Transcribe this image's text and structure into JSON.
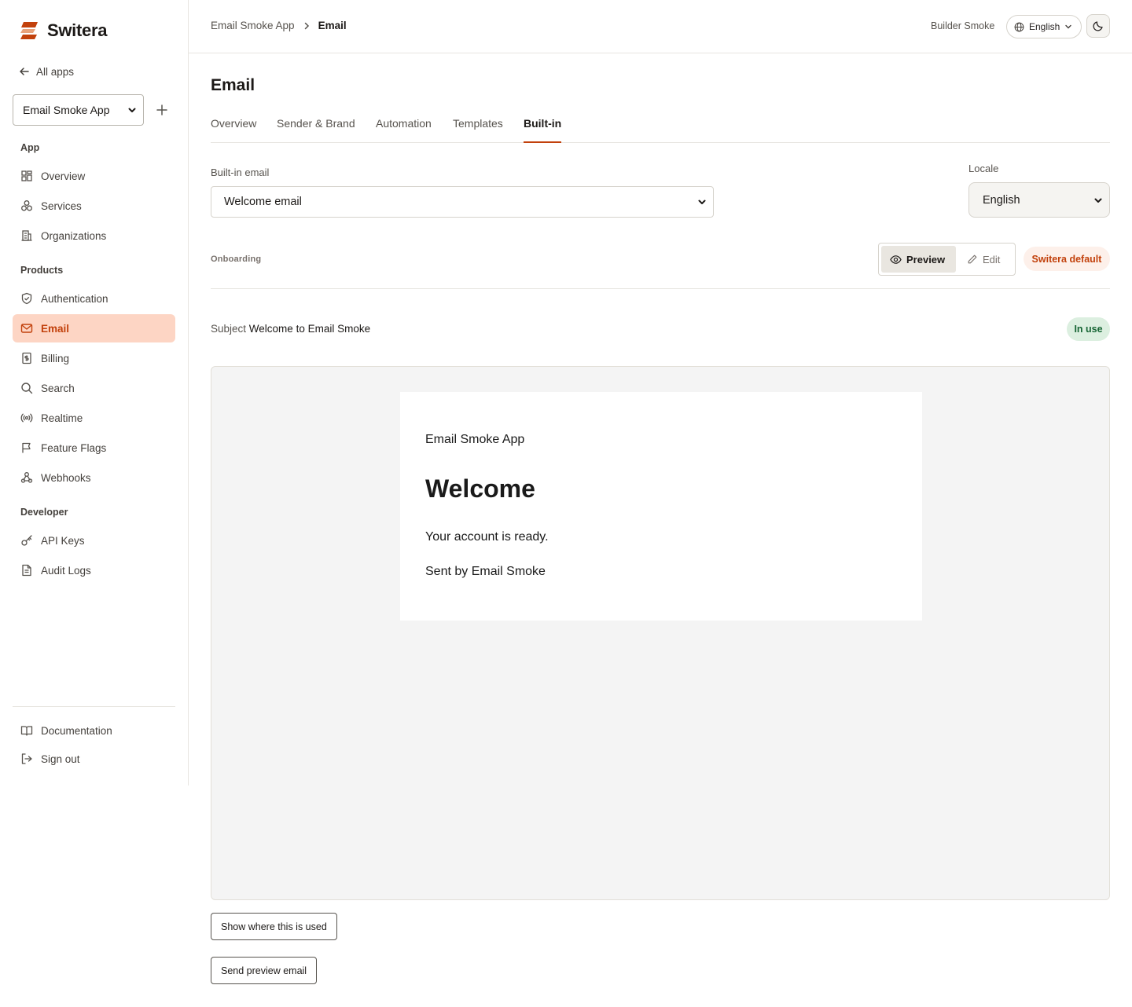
{
  "brand": {
    "name": "Switera",
    "accent": "#c2410c"
  },
  "sidebar": {
    "back_label": "All apps",
    "app_select_value": "Email Smoke App",
    "sections": {
      "app": "App",
      "products": "Products",
      "developer": "Developer"
    },
    "app_items": [
      {
        "label": "Overview",
        "icon": "overview-grid-icon"
      },
      {
        "label": "Services",
        "icon": "services-icon"
      },
      {
        "label": "Organizations",
        "icon": "building-icon"
      }
    ],
    "product_items": [
      {
        "label": "Authentication",
        "icon": "shield-icon"
      },
      {
        "label": "Email",
        "icon": "mail-icon",
        "active": true
      },
      {
        "label": "Billing",
        "icon": "receipt-icon"
      },
      {
        "label": "Search",
        "icon": "search-icon"
      },
      {
        "label": "Realtime",
        "icon": "broadcast-icon"
      },
      {
        "label": "Feature Flags",
        "icon": "flag-icon"
      },
      {
        "label": "Webhooks",
        "icon": "webhook-icon"
      }
    ],
    "developer_items": [
      {
        "label": "API Keys",
        "icon": "key-icon"
      },
      {
        "label": "Audit Logs",
        "icon": "file-icon"
      }
    ],
    "footer_items": [
      {
        "label": "Documentation",
        "icon": "book-icon"
      },
      {
        "label": "Sign out",
        "icon": "sign-out-icon"
      }
    ]
  },
  "header": {
    "breadcrumb": [
      "Email Smoke App",
      "Email"
    ],
    "user_name": "Builder Smoke",
    "language": "English"
  },
  "main": {
    "title": "Email",
    "tabs": [
      "Overview",
      "Sender & Brand",
      "Automation",
      "Templates",
      "Built-in"
    ],
    "active_tab": "Built-in",
    "builtin_label": "Built-in email",
    "builtin_value": "Welcome email",
    "locale_label": "Locale",
    "locale_value": "English",
    "section_tag": "Onboarding",
    "mode_preview": "Preview",
    "mode_edit": "Edit",
    "default_badge": "Switera default",
    "subject_label": "Subject",
    "subject_value": "Welcome to Email Smoke",
    "status_badge": "In use",
    "email_preview": {
      "app_name": "Email Smoke App",
      "heading": "Welcome",
      "body": "Your account is ready.",
      "footer": "Sent by Email Smoke"
    },
    "show_usage_button": "Show where this is used",
    "send_preview_button": "Send preview email"
  }
}
